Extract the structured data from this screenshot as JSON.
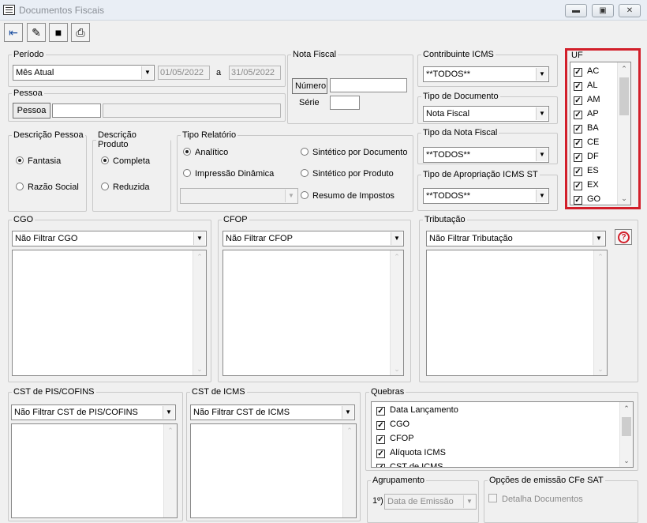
{
  "window": {
    "title": "Documentos Fiscais"
  },
  "toolbar": {
    "icons": [
      "exit-icon",
      "eraser-icon",
      "save-icon",
      "print-icon"
    ]
  },
  "periodo": {
    "legend": "Período",
    "selected": "Mês Atual",
    "date_from": "01/05/2022",
    "date_sep": "a",
    "date_to": "31/05/2022"
  },
  "pessoa": {
    "legend": "Pessoa",
    "button": "Pessoa",
    "code": "",
    "name": ""
  },
  "nota_fiscal": {
    "legend": "Nota Fiscal",
    "numero_button": "Número",
    "numero_value": "",
    "serie_label": "Série",
    "serie_value": ""
  },
  "contribuinte": {
    "legend": "Contribuinte ICMS",
    "selected": "**TODOS**"
  },
  "tipo_documento": {
    "legend": "Tipo de Documento",
    "selected": "Nota Fiscal"
  },
  "tipo_nota": {
    "legend": "Tipo da Nota Fiscal",
    "selected": "**TODOS**"
  },
  "tipo_apropriacao": {
    "legend": "Tipo de Apropriação ICMS ST",
    "selected": "**TODOS**"
  },
  "uf": {
    "legend": "UF",
    "items": [
      "AC",
      "AL",
      "AM",
      "AP",
      "BA",
      "CE",
      "DF",
      "ES",
      "EX",
      "GO"
    ]
  },
  "descricao_pessoa": {
    "legend": "Descrição Pessoa",
    "options": [
      "Fantasia",
      "Razão Social"
    ],
    "selected": "Fantasia"
  },
  "descricao_produto": {
    "legend": "Descrição Produto",
    "options": [
      "Completa",
      "Reduzida"
    ],
    "selected": "Completa"
  },
  "tipo_relatorio": {
    "legend": "Tipo Relatório",
    "options": [
      "Analítico",
      "Impressão Dinâmica",
      "Sintético por Documento",
      "Sintético por Produto",
      "Resumo de Impostos"
    ],
    "selected": "Analítico",
    "combo_value": ""
  },
  "cgo": {
    "legend": "CGO",
    "selected": "Não Filtrar CGO"
  },
  "cfop": {
    "legend": "CFOP",
    "selected": "Não Filtrar CFOP"
  },
  "tributacao": {
    "legend": "Tributação",
    "selected": "Não Filtrar Tributação",
    "help": "?"
  },
  "cst_pis": {
    "legend": "CST de PIS/COFINS",
    "selected": "Não Filtrar CST de PIS/COFINS"
  },
  "cst_icms": {
    "legend": "CST de ICMS",
    "selected": "Não Filtrar CST de ICMS"
  },
  "quebras": {
    "legend": "Quebras",
    "items": [
      "Data Lançamento",
      "CGO",
      "CFOP",
      "Alíquota ICMS",
      "CST de ICMS"
    ]
  },
  "agrupamento": {
    "legend": "Agrupamento",
    "index_label": "1º)",
    "selected": "Data de Emissão"
  },
  "cfe_sat": {
    "legend": "Opções de emissão CFe SAT",
    "detalha": "Detalha Documentos"
  }
}
